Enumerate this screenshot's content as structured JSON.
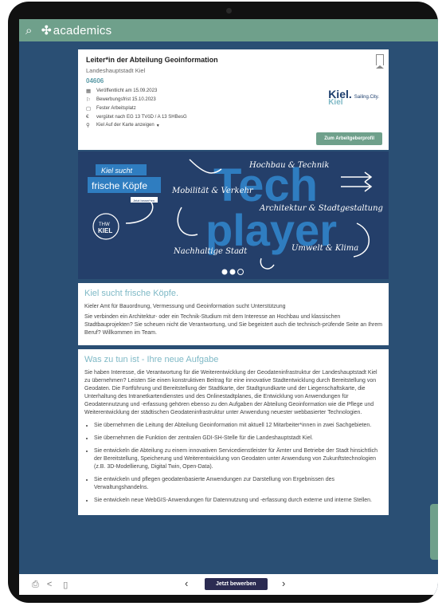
{
  "app": {
    "logo_text": "academics",
    "logo_mark": "✣"
  },
  "job": {
    "title": "Leiter*in der Abteilung Geoinformation",
    "employer": "Landeshauptstadt Kiel",
    "id": "04606",
    "meta": [
      {
        "icon": "calendar-icon",
        "glyph": "▦",
        "text": "Veröffentlicht am 15.09.2023"
      },
      {
        "icon": "flag-icon",
        "glyph": "⚐",
        "text": "Bewerbungsfrist 15.10.2023"
      },
      {
        "icon": "briefcase-icon",
        "glyph": "▢",
        "text": "Fester Arbeitsplatz"
      },
      {
        "icon": "euro-icon",
        "glyph": "€",
        "text": "vergütet nach EG 13 TVöD / A 13 SHBesG"
      },
      {
        "icon": "location-icon",
        "glyph": "⚲",
        "text": "Kiel Auf der Karte anzeigen"
      }
    ],
    "logo": {
      "main": "Kiel.",
      "sub": "Kiel",
      "tagline": "Sailing.City."
    },
    "profile_button": "Zum Arbeitgeberprofil"
  },
  "banner": {
    "kiel_sucht": "Kiel sucht",
    "frische": "frische Köpfe",
    "stamp": "Jetzt bewerben",
    "badge_line1": "THW",
    "badge_line2": "KIEL",
    "tech": "Tech",
    "player": "player",
    "topics": {
      "hochbau": "Hochbau & Technik",
      "mobilitaet": "Mobilität & Verkehr",
      "architektur": "Architektur & Stadtgestaltung",
      "nachhaltig": "Nachhaltige Stadt",
      "umwelt": "Umwelt & Klima"
    }
  },
  "intro": {
    "heading": "Kiel sucht frische Köpfe.",
    "p1": "Kieler Amt für Bauordnung, Vermessung und Geoinformation sucht Unterstützung",
    "p2": "Sie verbinden ein Architektur- oder ein Technik-Studium mit dem Interesse an Hochbau und klassischen Stadtbauprojekten? Sie scheuen nicht die Verantwortung, und Sie begeistert auch die technisch-prüfende Seite an Ihrem Beruf? Willkommen im Team."
  },
  "tasks": {
    "heading": "Was zu tun ist - Ihre neue Aufgabe",
    "p1": "Sie haben Interesse, die Verantwortung für die Weiterentwicklung der Geodateninfrastruktur der Landeshauptstadt Kiel zu übernehmen? Leisten Sie einen konstruktiven Beitrag für eine innovative Stadtentwicklung durch Bereitstellung von Geodaten. Die Fortführung und Bereitstellung der Stadtkarte, der Stadtgrundkarte und der Liegenschaftskarte, die Unterhaltung des Intranetkartendienstes und des Onlinestadtplanes, die Entwicklung von Anwendungen für Geodatennutzung und -erfassung gehören ebenso zu den Aufgaben der Abteilung Geoinformation wie die Pflege und Weiterentwicklung der städtischen Geodateninfrastruktur unter Anwendung neuester webbasierter Technologien.",
    "items": [
      "Sie übernehmen die Leitung der Abteilung Geoinformation mit aktuell 12 Mitarbeiter*innen in zwei Sachgebieten.",
      "Sie übernehmen die Funktion der zentralen GDI-SH-Stelle für die Landeshauptstadt Kiel.",
      "Sie entwickeln die Abteilung zu einem innovativen Servicedienstleister für Ämter und Betriebe der Stadt hinsichtlich der Bereitstellung, Speicherung und Weiterentwicklung von Geodaten unter Anwendung von Zukunftstechnologien (z.B. 3D-Modellierung, Digital Twin, Open-Data).",
      "Sie entwickeln und pflegen geodatenbasierte Anwendungen zur Darstellung von Ergebnissen des Verwaltungshandelns.",
      "Sie entwickeln neue WebGIS-Anwendungen für Datennutzung und -erfassung durch externe und interne Stellen."
    ]
  },
  "bottom": {
    "apply": "Jetzt bewerben",
    "prev": "‹",
    "next": "›"
  },
  "colors": {
    "accent": "#6fa08b",
    "heading": "#7fb9c6",
    "navy": "#243f6a"
  }
}
